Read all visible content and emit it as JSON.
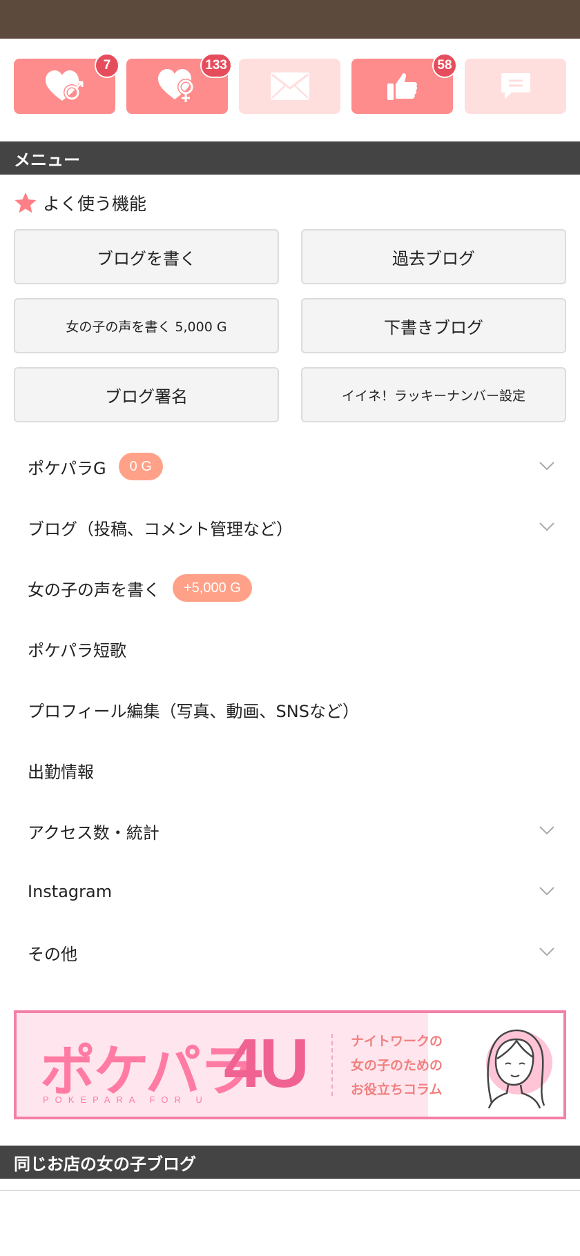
{
  "notifications": [
    {
      "name": "heart-male",
      "badge": "7",
      "state": "active"
    },
    {
      "name": "heart-female",
      "badge": "133",
      "state": "active"
    },
    {
      "name": "mail",
      "badge": "",
      "state": "inactive"
    },
    {
      "name": "thumbs-up",
      "badge": "58",
      "state": "active"
    },
    {
      "name": "comment",
      "badge": "",
      "state": "inactive"
    }
  ],
  "menu_section": {
    "title": "メニュー"
  },
  "favorites": {
    "title": "よく使う機能",
    "buttons": [
      "ブログを書く",
      "過去ブログ",
      "女の子の声を書く 5,000 G",
      "下書きブログ",
      "ブログ署名",
      "イイネ！ラッキーナンバー設定"
    ]
  },
  "menu_items": [
    {
      "label": "ポケパラG",
      "pill": "0 G",
      "chevron": true
    },
    {
      "label": "ブログ（投稿、コメント管理など）",
      "chevron": true
    },
    {
      "label": "女の子の声を書く",
      "pill": "+5,000 G",
      "chevron": false
    },
    {
      "label": "ポケパラ短歌",
      "chevron": false
    },
    {
      "label": "プロフィール編集（写真、動画、SNSなど）",
      "chevron": false
    },
    {
      "label": "出勤情報",
      "chevron": false
    },
    {
      "label": "アクセス数・統計",
      "chevron": true
    },
    {
      "label": "Instagram",
      "chevron": true
    },
    {
      "label": "その他",
      "chevron": true
    }
  ],
  "banner": {
    "logo_text": "ポケパラ",
    "logo_suffix": "4U",
    "logo_sub": "POKEPARA FOR U",
    "copy_lines": [
      "ナイトワークの",
      "女の子のための",
      "お役立ちコラム"
    ]
  },
  "same_shop_section": {
    "title": "同じお店の女の子ブログ"
  },
  "colors": {
    "topbar": "#5c4a3d",
    "icon_active": "#ff8c8c",
    "icon_inactive": "#ffdede",
    "badge": "#e64d5c",
    "section_bar": "#444444",
    "pill": "#ffa188",
    "star": "#ff7f86"
  }
}
